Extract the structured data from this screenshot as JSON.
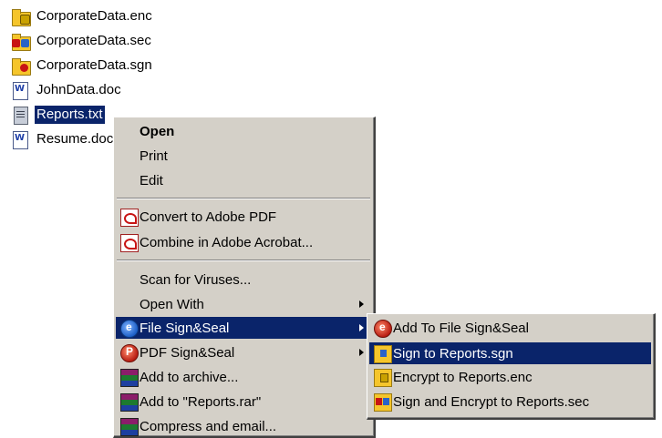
{
  "files": [
    {
      "name": "CorporateData.enc",
      "icon": "encrypted-folder-icon"
    },
    {
      "name": "CorporateData.sec",
      "icon": "signed-encrypted-folder-icon"
    },
    {
      "name": "CorporateData.sgn",
      "icon": "signed-folder-icon"
    },
    {
      "name": "JohnData.doc",
      "icon": "word-document-icon"
    },
    {
      "name": "Reports.txt",
      "icon": "text-file-icon",
      "selected": true
    },
    {
      "name": "Resume.doc",
      "icon": "word-document-icon"
    }
  ],
  "context_menu": {
    "items": [
      {
        "label": "Open",
        "bold": true
      },
      {
        "label": "Print"
      },
      {
        "label": "Edit"
      },
      {
        "label": "Convert to Adobe PDF",
        "icon": "acrobat-icon"
      },
      {
        "label": "Combine in Adobe Acrobat...",
        "icon": "acrobat-icon"
      },
      {
        "label": "Scan for Viruses..."
      },
      {
        "label": "Open With",
        "submenu": true
      },
      {
        "label": "File Sign&Seal",
        "icon": "file-sign-seal-icon",
        "submenu": true,
        "highlighted": true
      },
      {
        "label": "PDF Sign&Seal",
        "icon": "pdf-sign-seal-icon",
        "submenu": true
      },
      {
        "label": "Add to archive...",
        "icon": "winrar-icon"
      },
      {
        "label": "Add to \"Reports.rar\"",
        "icon": "winrar-icon"
      },
      {
        "label": "Compress and email...",
        "icon": "winrar-icon"
      }
    ]
  },
  "submenu": {
    "items": [
      {
        "label": "Add To File Sign&Seal",
        "icon": "file-sign-seal-icon"
      },
      {
        "label": "Sign to Reports.sgn",
        "icon": "sign-folder-icon",
        "highlighted": true
      },
      {
        "label": "Encrypt to Reports.enc",
        "icon": "encrypt-folder-icon"
      },
      {
        "label": "Sign and Encrypt to Reports.sec",
        "icon": "sign-encrypt-folder-icon"
      }
    ]
  },
  "colors": {
    "selection": "#0a246a",
    "menu_face": "#d4d0c8",
    "selection_text": "#ffffff"
  }
}
